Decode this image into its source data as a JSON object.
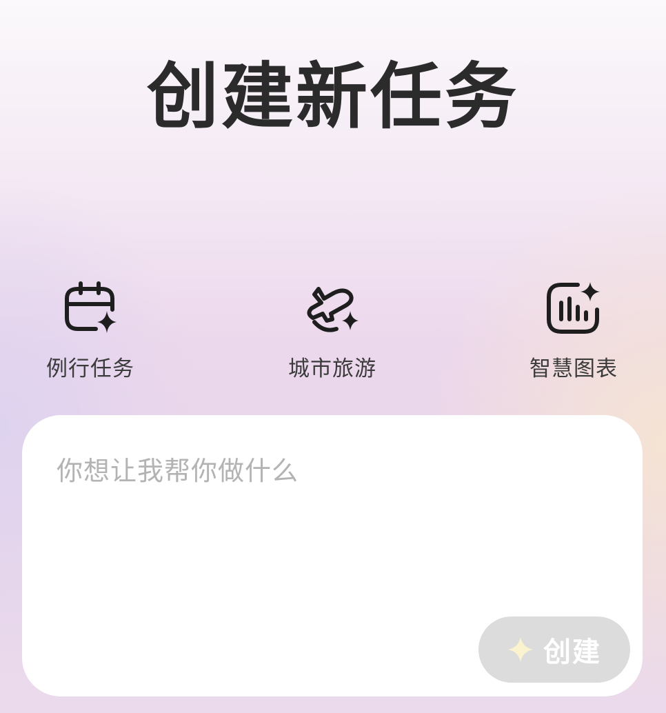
{
  "header": {
    "title": "创建新任务"
  },
  "quick_actions": [
    {
      "label": "例行任务",
      "icon": "calendar-sparkle-icon"
    },
    {
      "label": "城市旅游",
      "icon": "airplane-sparkle-icon"
    },
    {
      "label": "智慧图表",
      "icon": "chart-sparkle-icon"
    }
  ],
  "prompt": {
    "placeholder": "你想让我帮你做什么",
    "value": ""
  },
  "create_button": {
    "label": "创建",
    "icon": "sparkle-icon",
    "state": "disabled"
  },
  "colors": {
    "title": "#2b2b2b",
    "icon_stroke": "#1e1e1e",
    "placeholder": "#b3b3b3",
    "button_bg": "#dcdcdc",
    "button_sparkle": "#fbf3cf"
  }
}
